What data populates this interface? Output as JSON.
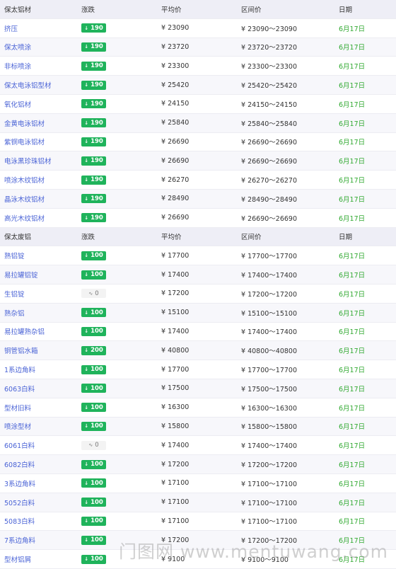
{
  "sections": [
    {
      "header": {
        "name": "保太铝材",
        "change": "涨跌",
        "avg": "平均价",
        "range": "区间价",
        "date": "日期"
      },
      "rows": [
        {
          "name": "挤压",
          "change": "190",
          "dir": "down",
          "avg": "¥ 23090",
          "range": "¥ 23090～23090",
          "date": "6月17日"
        },
        {
          "name": "保太喷涂",
          "change": "190",
          "dir": "down",
          "avg": "¥ 23720",
          "range": "¥ 23720～23720",
          "date": "6月17日"
        },
        {
          "name": "非标喷涂",
          "change": "190",
          "dir": "down",
          "avg": "¥ 23300",
          "range": "¥ 23300～23300",
          "date": "6月17日"
        },
        {
          "name": "保太电泳铝型材",
          "change": "190",
          "dir": "down",
          "avg": "¥ 25420",
          "range": "¥ 25420～25420",
          "date": "6月17日"
        },
        {
          "name": "氧化铝材",
          "change": "190",
          "dir": "down",
          "avg": "¥ 24150",
          "range": "¥ 24150～24150",
          "date": "6月17日"
        },
        {
          "name": "金黄电泳铝材",
          "change": "190",
          "dir": "down",
          "avg": "¥ 25840",
          "range": "¥ 25840～25840",
          "date": "6月17日"
        },
        {
          "name": "紫铜电泳铝材",
          "change": "190",
          "dir": "down",
          "avg": "¥ 26690",
          "range": "¥ 26690～26690",
          "date": "6月17日"
        },
        {
          "name": "电泳黑珍珠铝材",
          "change": "190",
          "dir": "down",
          "avg": "¥ 26690",
          "range": "¥ 26690～26690",
          "date": "6月17日"
        },
        {
          "name": "喷涂木纹铝材",
          "change": "190",
          "dir": "down",
          "avg": "¥ 26270",
          "range": "¥ 26270～26270",
          "date": "6月17日"
        },
        {
          "name": "晶泳木纹铝材",
          "change": "190",
          "dir": "down",
          "avg": "¥ 28490",
          "range": "¥ 28490～28490",
          "date": "6月17日"
        },
        {
          "name": "高光木纹铝材",
          "change": "190",
          "dir": "down",
          "avg": "¥ 26690",
          "range": "¥ 26690～26690",
          "date": "6月17日"
        }
      ]
    },
    {
      "header": {
        "name": "保太废铝",
        "change": "涨跌",
        "avg": "平均价",
        "range": "区间价",
        "date": "日期"
      },
      "rows": [
        {
          "name": "熟铝锭",
          "change": "100",
          "dir": "down",
          "avg": "¥ 17700",
          "range": "¥ 17700～17700",
          "date": "6月17日"
        },
        {
          "name": "易拉罐铝锭",
          "change": "100",
          "dir": "down",
          "avg": "¥ 17400",
          "range": "¥ 17400～17400",
          "date": "6月17日"
        },
        {
          "name": "生铝锭",
          "change": "0",
          "dir": "flat",
          "avg": "¥ 17200",
          "range": "¥ 17200～17200",
          "date": "6月17日"
        },
        {
          "name": "熟杂铝",
          "change": "100",
          "dir": "down",
          "avg": "¥ 15100",
          "range": "¥ 15100～15100",
          "date": "6月17日"
        },
        {
          "name": "易拉罐熟杂铝",
          "change": "100",
          "dir": "down",
          "avg": "¥ 17400",
          "range": "¥ 17400～17400",
          "date": "6月17日"
        },
        {
          "name": "铜管铝水箱",
          "change": "200",
          "dir": "down",
          "avg": "¥ 40800",
          "range": "¥ 40800～40800",
          "date": "6月17日"
        },
        {
          "name": "1系边角料",
          "change": "100",
          "dir": "down",
          "avg": "¥ 17700",
          "range": "¥ 17700～17700",
          "date": "6月17日"
        },
        {
          "name": "6063白料",
          "change": "100",
          "dir": "down",
          "avg": "¥ 17500",
          "range": "¥ 17500～17500",
          "date": "6月17日"
        },
        {
          "name": "型材旧料",
          "change": "100",
          "dir": "down",
          "avg": "¥ 16300",
          "range": "¥ 16300～16300",
          "date": "6月17日"
        },
        {
          "name": "喷涂型材",
          "change": "100",
          "dir": "down",
          "avg": "¥ 15800",
          "range": "¥ 15800～15800",
          "date": "6月17日"
        },
        {
          "name": "6061白料",
          "change": "0",
          "dir": "flat",
          "avg": "¥ 17400",
          "range": "¥ 17400～17400",
          "date": "6月17日"
        },
        {
          "name": "6082白料",
          "change": "100",
          "dir": "down",
          "avg": "¥ 17200",
          "range": "¥ 17200～17200",
          "date": "6月17日"
        },
        {
          "name": "3系边角料",
          "change": "100",
          "dir": "down",
          "avg": "¥ 17100",
          "range": "¥ 17100～17100",
          "date": "6月17日"
        },
        {
          "name": "5052白料",
          "change": "100",
          "dir": "down",
          "avg": "¥ 17100",
          "range": "¥ 17100～17100",
          "date": "6月17日"
        },
        {
          "name": "5083白料",
          "change": "100",
          "dir": "down",
          "avg": "¥ 17100",
          "range": "¥ 17100～17100",
          "date": "6月17日"
        },
        {
          "name": "7系边角料",
          "change": "100",
          "dir": "down",
          "avg": "¥ 17200",
          "range": "¥ 17200～17200",
          "date": "6月17日"
        },
        {
          "name": "型材铝屑",
          "change": "100",
          "dir": "down",
          "avg": "¥ 9100",
          "range": "¥ 9100～9100",
          "date": "6月17日"
        }
      ]
    }
  ],
  "watermark": "门图网 www.mentuwang.com",
  "colors": {
    "down": "#1fb35b",
    "link": "#4a63d6",
    "date": "#33aa33",
    "header_bg": "#eeeef6"
  },
  "icons": {
    "down": "arrow-down-icon",
    "flat": "wave-icon"
  }
}
